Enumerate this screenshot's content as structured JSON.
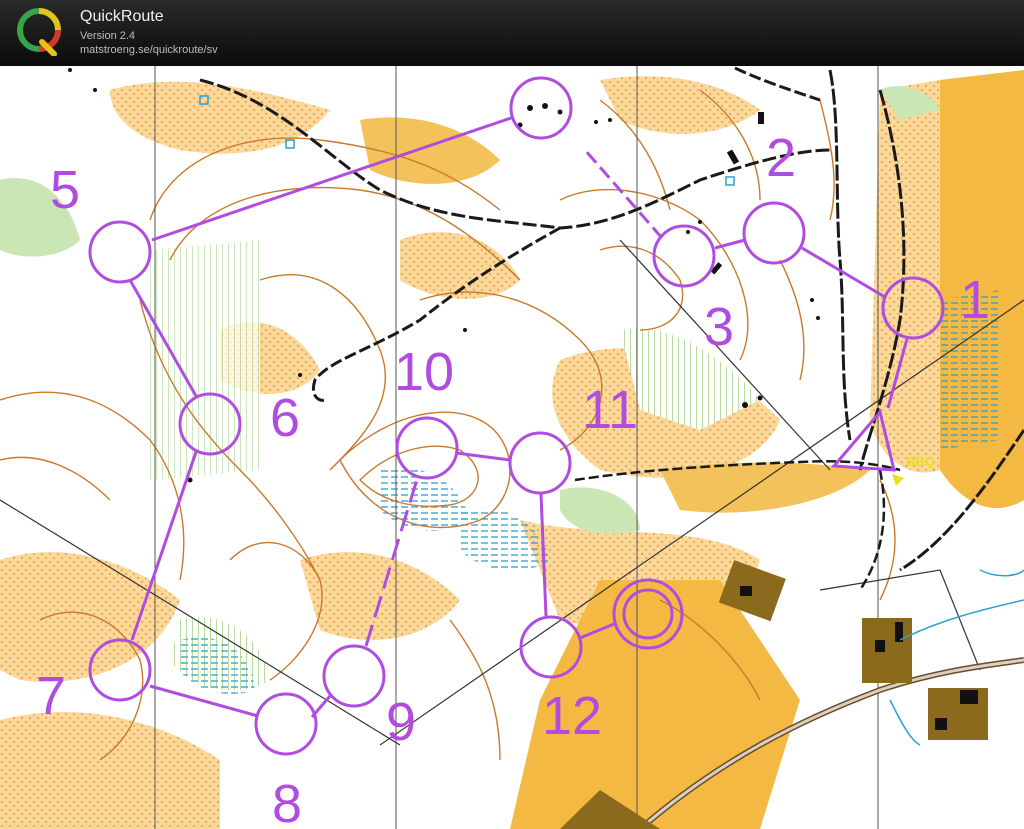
{
  "app": {
    "title": "QuickRoute",
    "version": "Version 2.4",
    "url": "matstroeng.se/quickroute/sv",
    "logo_letter": "Q"
  },
  "map": {
    "course_color": "#b04ce0",
    "start_label": "",
    "annotation": "BBQ",
    "controls": [
      {
        "id": "1",
        "label": "1"
      },
      {
        "id": "2",
        "label": "2"
      },
      {
        "id": "3",
        "label": "3"
      },
      {
        "id": "5",
        "label": "5"
      },
      {
        "id": "6",
        "label": "6"
      },
      {
        "id": "7",
        "label": "7"
      },
      {
        "id": "8",
        "label": "8"
      },
      {
        "id": "9",
        "label": "9"
      },
      {
        "id": "10",
        "label": "10"
      },
      {
        "id": "11",
        "label": "11"
      },
      {
        "id": "12",
        "label": "12"
      }
    ]
  }
}
